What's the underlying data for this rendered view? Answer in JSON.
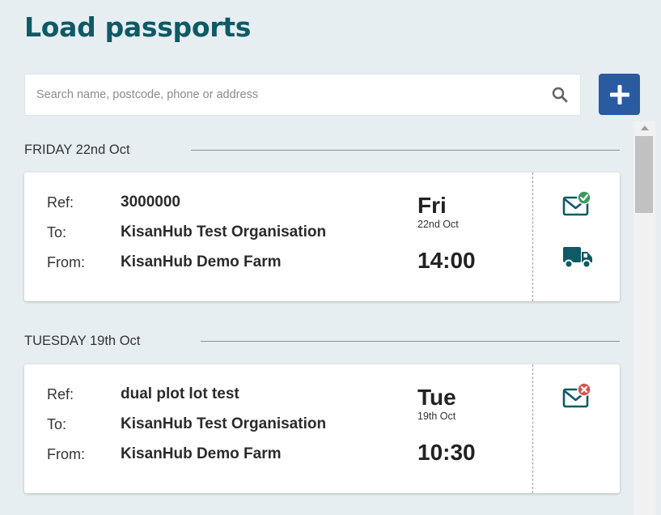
{
  "page": {
    "title": "Load passports"
  },
  "search": {
    "placeholder": "Search name, postcode, phone or address",
    "icon": "search-icon"
  },
  "toolbar": {
    "add_icon": "plus-icon"
  },
  "groups": [
    {
      "header": "FRIDAY 22nd Oct",
      "cards": [
        {
          "ref_label": "Ref:",
          "ref": "3000000",
          "to_label": "To:",
          "to": "KisanHub Test Organisation",
          "from_label": "From:",
          "from": "KisanHub Demo Farm",
          "day": "Fri",
          "date": "22nd Oct",
          "time": "14:00",
          "status_icon": "mail-sent-check-icon",
          "transport_icon": "truck-icon"
        }
      ]
    },
    {
      "header": "TUESDAY 19th Oct",
      "cards": [
        {
          "ref_label": "Ref:",
          "ref": "dual plot lot test",
          "to_label": "To:",
          "to": "KisanHub Test Organisation",
          "from_label": "From:",
          "from": "KisanHub Demo Farm",
          "day": "Tue",
          "date": "19th Oct",
          "time": "10:30",
          "status_icon": "mail-failed-x-icon"
        }
      ]
    }
  ],
  "colors": {
    "title": "#0e5a66",
    "accent": "#2a5aa0",
    "icon_teal": "#0e5a66",
    "success": "#3c9a5f",
    "error": "#d9534f",
    "background": "#e6eef2"
  }
}
